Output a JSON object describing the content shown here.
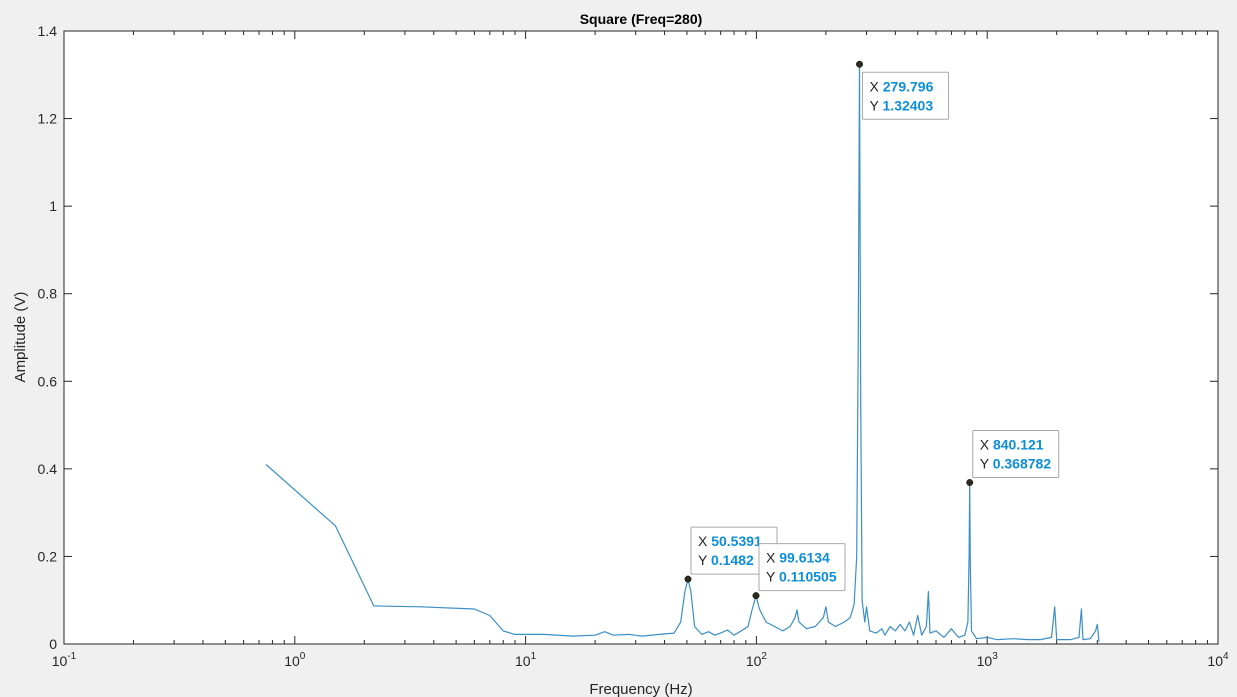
{
  "chart_data": {
    "type": "line",
    "title": "Square (Freq=280)",
    "xlabel": "Frequency (Hz)",
    "ylabel": "Amplitude (V)",
    "xscale": "log",
    "xlim": [
      0.1,
      10000
    ],
    "ylim": [
      0,
      1.4
    ],
    "grid": false,
    "legend": "none",
    "x_ticks": [
      {
        "value": 0.1,
        "base": "10",
        "exp": "-1"
      },
      {
        "value": 1,
        "base": "10",
        "exp": "0"
      },
      {
        "value": 10,
        "base": "10",
        "exp": "1"
      },
      {
        "value": 100,
        "base": "10",
        "exp": "2"
      },
      {
        "value": 1000,
        "base": "10",
        "exp": "3"
      },
      {
        "value": 10000,
        "base": "10",
        "exp": "4"
      }
    ],
    "y_ticks": [
      {
        "value": 0,
        "label": "0"
      },
      {
        "value": 0.2,
        "label": "0.2"
      },
      {
        "value": 0.4,
        "label": "0.4"
      },
      {
        "value": 0.6,
        "label": "0.6"
      },
      {
        "value": 0.8,
        "label": "0.8"
      },
      {
        "value": 1.0,
        "label": "1"
      },
      {
        "value": 1.2,
        "label": "1.2"
      },
      {
        "value": 1.4,
        "label": "1.4"
      }
    ],
    "series": [
      {
        "color": "#3a8fc6",
        "points": [
          [
            0.75,
            0.41
          ],
          [
            1.5,
            0.27
          ],
          [
            2.2,
            0.087
          ],
          [
            3.5,
            0.085
          ],
          [
            6.0,
            0.08
          ],
          [
            7.0,
            0.065
          ],
          [
            8.0,
            0.03
          ],
          [
            9.0,
            0.022
          ],
          [
            12.0,
            0.022
          ],
          [
            16.0,
            0.018
          ],
          [
            20.0,
            0.02
          ],
          [
            22.0,
            0.028
          ],
          [
            24.0,
            0.02
          ],
          [
            28.0,
            0.022
          ],
          [
            32.0,
            0.018
          ],
          [
            38.0,
            0.022
          ],
          [
            44.0,
            0.025
          ],
          [
            47.0,
            0.05
          ],
          [
            49.0,
            0.12
          ],
          [
            50.54,
            0.1482
          ],
          [
            52.0,
            0.12
          ],
          [
            54.0,
            0.04
          ],
          [
            58.0,
            0.022
          ],
          [
            62.0,
            0.028
          ],
          [
            66.0,
            0.02
          ],
          [
            70.0,
            0.025
          ],
          [
            75.0,
            0.032
          ],
          [
            80.0,
            0.02
          ],
          [
            86.0,
            0.03
          ],
          [
            92.0,
            0.04
          ],
          [
            96.0,
            0.08
          ],
          [
            99.61,
            0.110505
          ],
          [
            103.0,
            0.08
          ],
          [
            110.0,
            0.05
          ],
          [
            120.0,
            0.04
          ],
          [
            130.0,
            0.03
          ],
          [
            140.0,
            0.04
          ],
          [
            147.0,
            0.06
          ],
          [
            150.0,
            0.078
          ],
          [
            153.0,
            0.05
          ],
          [
            165.0,
            0.035
          ],
          [
            180.0,
            0.04
          ],
          [
            195.0,
            0.06
          ],
          [
            200.0,
            0.085
          ],
          [
            205.0,
            0.05
          ],
          [
            220.0,
            0.04
          ],
          [
            240.0,
            0.05
          ],
          [
            255.0,
            0.06
          ],
          [
            265.0,
            0.09
          ],
          [
            272.0,
            0.2
          ],
          [
            276.0,
            0.68
          ],
          [
            279.8,
            1.32403
          ],
          [
            283.0,
            0.56
          ],
          [
            287.0,
            0.1
          ],
          [
            295.0,
            0.05
          ],
          [
            300.0,
            0.085
          ],
          [
            310.0,
            0.03
          ],
          [
            330.0,
            0.025
          ],
          [
            350.0,
            0.035
          ],
          [
            360.0,
            0.02
          ],
          [
            380.0,
            0.04
          ],
          [
            400.0,
            0.03
          ],
          [
            420.0,
            0.045
          ],
          [
            440.0,
            0.03
          ],
          [
            460.0,
            0.05
          ],
          [
            480.0,
            0.02
          ],
          [
            500.0,
            0.065
          ],
          [
            520.0,
            0.02
          ],
          [
            545.0,
            0.04
          ],
          [
            556.0,
            0.12
          ],
          [
            565.0,
            0.025
          ],
          [
            600.0,
            0.03
          ],
          [
            650.0,
            0.015
          ],
          [
            700.0,
            0.035
          ],
          [
            750.0,
            0.015
          ],
          [
            800.0,
            0.02
          ],
          [
            825.0,
            0.05
          ],
          [
            835.0,
            0.2
          ],
          [
            840.12,
            0.368782
          ],
          [
            845.0,
            0.18
          ],
          [
            855.0,
            0.03
          ],
          [
            900.0,
            0.012
          ],
          [
            1000.0,
            0.015
          ],
          [
            1100.0,
            0.01
          ],
          [
            1300.0,
            0.012
          ],
          [
            1500.0,
            0.01
          ],
          [
            1700.0,
            0.01
          ],
          [
            1900.0,
            0.015
          ],
          [
            1960.0,
            0.085
          ],
          [
            2000.0,
            0.01
          ],
          [
            2300.0,
            0.01
          ],
          [
            2500.0,
            0.015
          ],
          [
            2560.0,
            0.08
          ],
          [
            2600.0,
            0.01
          ],
          [
            2800.0,
            0.012
          ],
          [
            2950.0,
            0.03
          ],
          [
            3000.0,
            0.045
          ],
          [
            3050.0,
            0.005
          ]
        ]
      }
    ],
    "datatips": [
      {
        "x": 279.8,
        "y": 1.32403,
        "x_label": "X",
        "y_label": "Y",
        "x_text": "279.796",
        "y_text": "1.32403",
        "box_side": "right-below"
      },
      {
        "x": 840.12,
        "y": 0.368782,
        "x_label": "X",
        "y_label": "Y",
        "x_text": "840.121",
        "y_text": "0.368782",
        "box_side": "right-above"
      },
      {
        "x": 50.54,
        "y": 0.1482,
        "x_label": "X",
        "y_label": "Y",
        "x_text": "50.5391",
        "y_text": "0.1482",
        "box_side": "right-above"
      },
      {
        "x": 99.61,
        "y": 0.110505,
        "x_label": "X",
        "y_label": "Y",
        "x_text": "99.6134",
        "y_text": "0.110505",
        "box_side": "right-above"
      }
    ],
    "tip_value_color": "#0c8fd8"
  }
}
